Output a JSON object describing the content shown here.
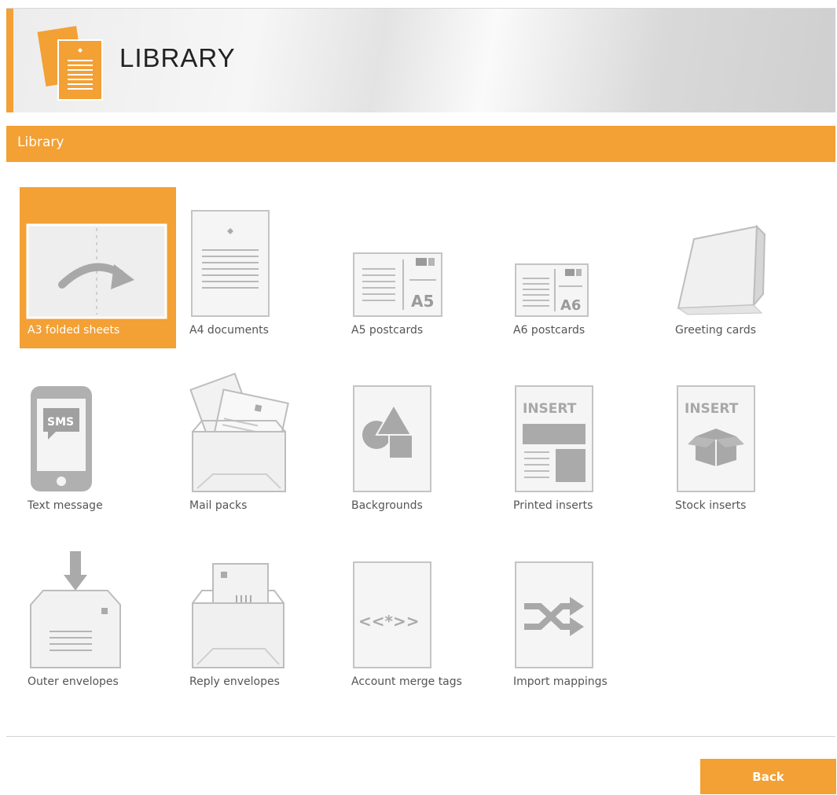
{
  "app": {
    "title": "LIBRARY"
  },
  "section": {
    "title": "Library"
  },
  "items": [
    {
      "label": "A3 folded sheets",
      "icon": "folded-sheet-icon",
      "selected": true
    },
    {
      "label": "A4 documents",
      "icon": "a4-document-icon"
    },
    {
      "label": "A5 postcards",
      "icon": "a5-postcard-icon",
      "icon_text": "A5"
    },
    {
      "label": "A6 postcards",
      "icon": "a6-postcard-icon",
      "icon_text": "A6"
    },
    {
      "label": "Greeting cards",
      "icon": "greeting-card-icon"
    },
    {
      "label": "Text message",
      "icon": "sms-phone-icon",
      "icon_text": "SMS"
    },
    {
      "label": "Mail packs",
      "icon": "mail-pack-icon"
    },
    {
      "label": "Backgrounds",
      "icon": "background-shapes-icon"
    },
    {
      "label": "Printed inserts",
      "icon": "printed-insert-icon",
      "icon_text": "INSERT"
    },
    {
      "label": "Stock inserts",
      "icon": "stock-insert-icon",
      "icon_text": "INSERT"
    },
    {
      "label": "Outer envelopes",
      "icon": "outer-envelope-icon"
    },
    {
      "label": "Reply envelopes",
      "icon": "reply-envelope-icon"
    },
    {
      "label": "Account merge tags",
      "icon": "merge-tag-icon",
      "icon_text": "<<*>>"
    },
    {
      "label": "Import mappings",
      "icon": "shuffle-icon"
    }
  ],
  "footer": {
    "back_label": "Back"
  },
  "colors": {
    "accent": "#f3a035",
    "icon_gray": "#b5b5b5",
    "label": "#555555"
  }
}
